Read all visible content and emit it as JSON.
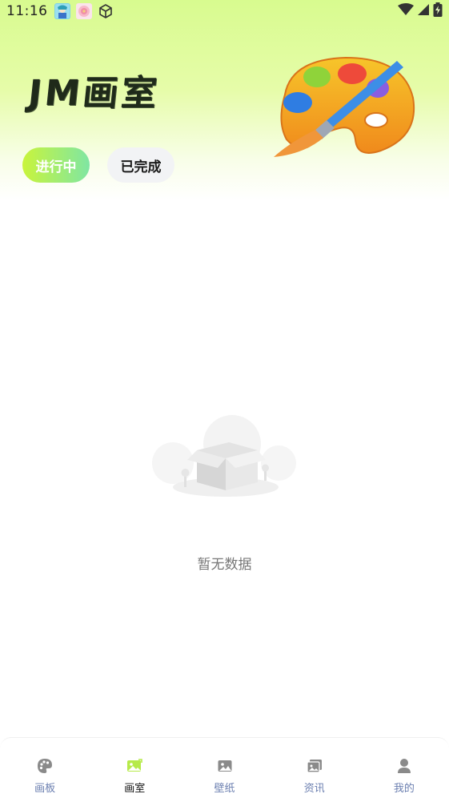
{
  "status_bar": {
    "time": "11:16",
    "notifications": [
      "anime-app-icon",
      "flower-app-icon",
      "cube-icon"
    ],
    "indicators": [
      "wifi-icon",
      "signal-icon",
      "battery-charging-icon"
    ]
  },
  "header": {
    "logo_text": "JM画室",
    "illustration": "paint-palette-with-brush"
  },
  "tabs": [
    {
      "label": "进行中",
      "active": true
    },
    {
      "label": "已完成",
      "active": false
    }
  ],
  "empty_state": {
    "illustration": "empty-box",
    "text": "暂无数据"
  },
  "bottom_nav": {
    "items": [
      {
        "label": "画板",
        "icon": "palette-icon",
        "active": false
      },
      {
        "label": "画室",
        "icon": "image-icon",
        "active": true
      },
      {
        "label": "壁纸",
        "icon": "picture-icon",
        "active": false
      },
      {
        "label": "资讯",
        "icon": "news-icon",
        "active": false
      },
      {
        "label": "我的",
        "icon": "user-icon",
        "active": false
      }
    ]
  },
  "colors": {
    "header_gradient_top": "#d8fb8f",
    "tab_active_gradient_start": "#c9f43b",
    "tab_active_gradient_end": "#7fe6a3",
    "nav_active_icon": "#b6ea4a",
    "nav_inactive": "#8a8a8a"
  }
}
